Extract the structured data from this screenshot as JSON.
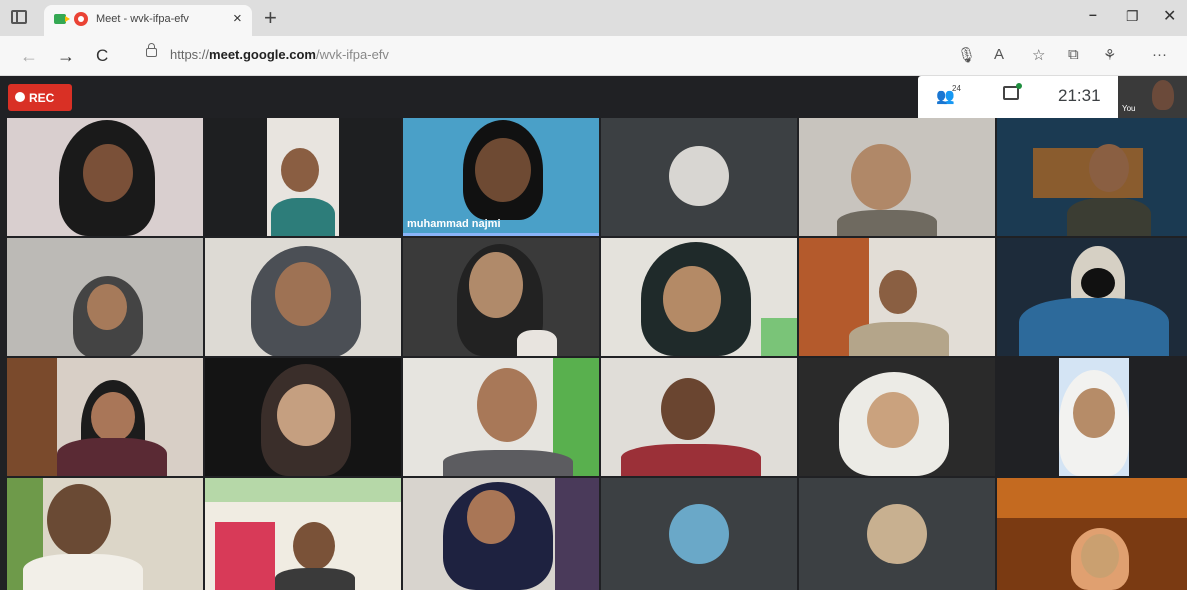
{
  "browser": {
    "tab_title": "Meet - wvk-ifpa-efv",
    "url_scheme": "https://",
    "url_domain": "meet.google.com",
    "url_path": "/wvk-ifpa-efv",
    "new_tab_glyph": "+",
    "close_tab_glyph": "×",
    "window_controls": {
      "minimize": "–",
      "maximize": "❐",
      "close": "✕"
    },
    "nav_glyphs": {
      "back": "←",
      "forward": "→",
      "reload": "C"
    },
    "toolbar_icons": [
      "mic-icon",
      "read-aloud-icon",
      "favorites-icon",
      "collections-icon",
      "extension-icon",
      "more-icon"
    ]
  },
  "meet": {
    "rec_label": "REC",
    "participant_count": "24",
    "clock": "21:31",
    "self_label": "You",
    "active_speaker_name": "muhammad najmi"
  },
  "colors": {
    "rec_red": "#d93025",
    "meet_bg": "#202124",
    "active_speaker_bar": "#8ab4f8"
  }
}
